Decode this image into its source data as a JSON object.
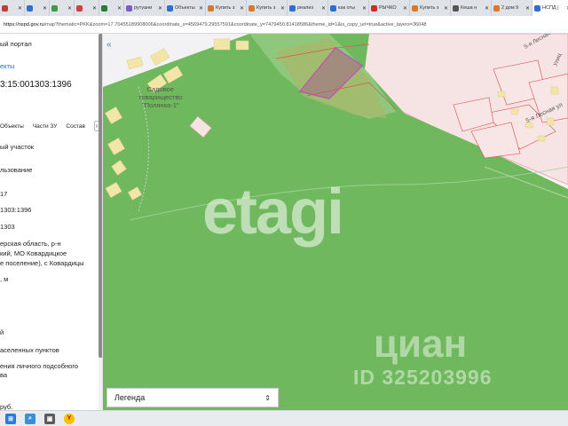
{
  "browser": {
    "tabs": [
      {
        "title": "",
        "color": "#c23b3b",
        "small": true
      },
      {
        "title": "",
        "color": "#2d6fd2",
        "small": true
      },
      {
        "title": "",
        "color": "#3a9b4a",
        "small": true
      },
      {
        "title": "",
        "color": "#d04040",
        "small": true
      },
      {
        "title": "",
        "color": "#1e7e34",
        "small": true
      },
      {
        "title": "рутуани",
        "color": "#7b5cc4"
      },
      {
        "title": "Объекты",
        "color": "#2d6fd2"
      },
      {
        "title": "Купить з",
        "color": "#d97a2b"
      },
      {
        "title": "Купить з",
        "color": "#d97a2b"
      },
      {
        "title": "реализ",
        "color": "#2d6fd2"
      },
      {
        "title": "как оты",
        "color": "#2d6fd2"
      },
      {
        "title": "РЫЧКО",
        "color": "#cc2b2b"
      },
      {
        "title": "Купить з",
        "color": "#d97a2b"
      },
      {
        "title": "Кеша н",
        "color": "#555555"
      },
      {
        "title": "2 дом 9",
        "color": "#d97a2b"
      },
      {
        "title": "НСПД |",
        "color": "#2d6fd2",
        "active": true
      }
    ],
    "url_host": "https://nspd.gov.ru",
    "url_rest": "/map?thematic=PKK&zoom=17.70455189908006&coordinate_x=4569479.29557591&coordinate_y=7479450.81418586&theme_id=1&is_copy_url=true&active_layers=36048"
  },
  "panel": {
    "portal_title": "ый портал",
    "objects_link": "екты",
    "cadastral_number": "3:15:001303:1396",
    "tabs": [
      "Объекты",
      "Части ЗУ",
      "Состав"
    ],
    "scroll_button": "›",
    "lines": [
      "ый участок",
      "льзование",
      "17",
      "1303:1396",
      "1303",
      "ерская область, р-н",
      "кий, МО Ковардицкое",
      "е поселение), с Ковардицы",
      ", м",
      "й",
      "аселенных пунктов",
      "ения личного подсобного",
      "ва",
      "руб."
    ],
    "scroll_level_percent": 86
  },
  "map": {
    "collapse_button": "«",
    "label_sadovoe": "Садовое\nтоварищество\n\"Полянка-1\"",
    "street_1": "5-я Лесная",
    "street_2": "5-я Лесная ул",
    "street_3": "Лесн",
    "street_4": "Улиц",
    "watermark_1": "etagi",
    "watermark_2": "циан",
    "watermark_3": "ID 325203996",
    "legend_label": "Легенда",
    "legend_chevron": "⌃⌄",
    "colors": {
      "green": "#6fb85e",
      "pink": "#f3dada",
      "highlight": "#b07ba8",
      "lot": "#f1e6a8"
    }
  },
  "taskbar": {
    "icons": [
      "windows-icon",
      "search-icon",
      "store-icon",
      "browser-icon"
    ]
  }
}
